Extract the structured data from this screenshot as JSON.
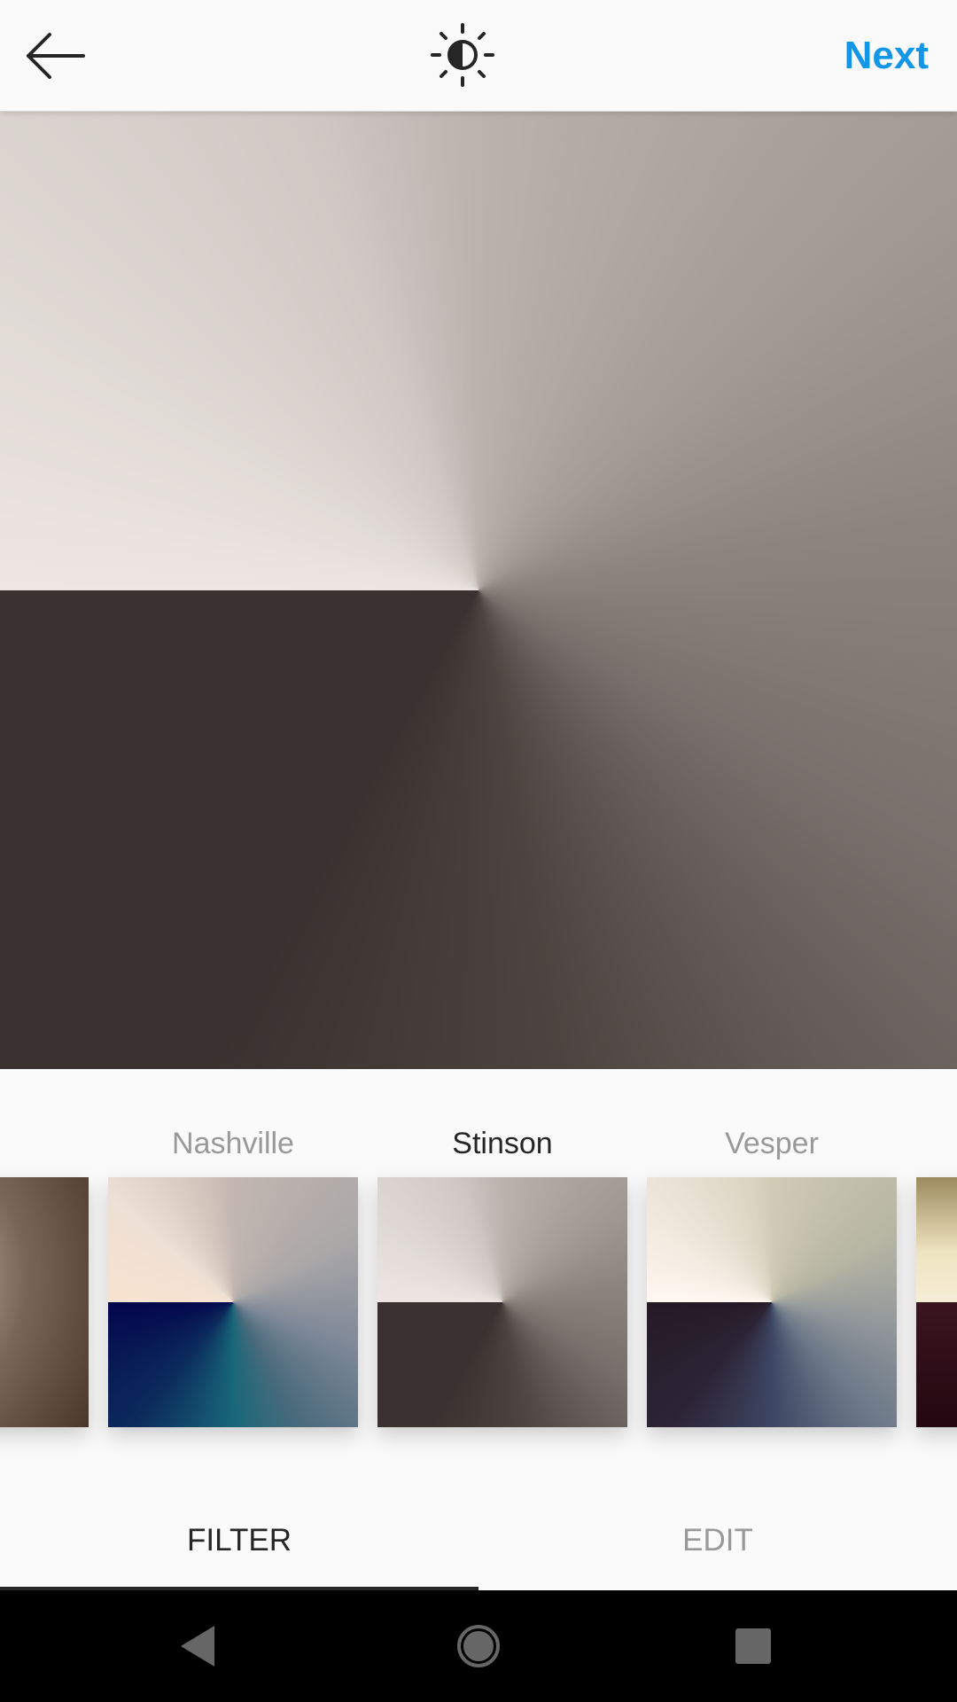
{
  "topbar": {
    "back_icon": "arrow-left-icon",
    "lux_icon": "brightness-contrast-icon",
    "next_label": "Next",
    "accent_color": "#1496e8"
  },
  "photo": {
    "icon": "photo-preview",
    "filter": "Stinson"
  },
  "filters": [
    {
      "label": "",
      "active": false
    },
    {
      "label": "Nashville",
      "active": false
    },
    {
      "label": "Stinson",
      "active": true
    },
    {
      "label": "Vesper",
      "active": false
    },
    {
      "label": "",
      "active": false
    }
  ],
  "tabs": {
    "filter_label": "FILTER",
    "edit_label": "EDIT",
    "selected": "FILTER"
  },
  "navbar": {
    "back_icon": "nav-back-icon",
    "home_icon": "nav-home-icon",
    "recents_icon": "nav-recents-icon"
  }
}
